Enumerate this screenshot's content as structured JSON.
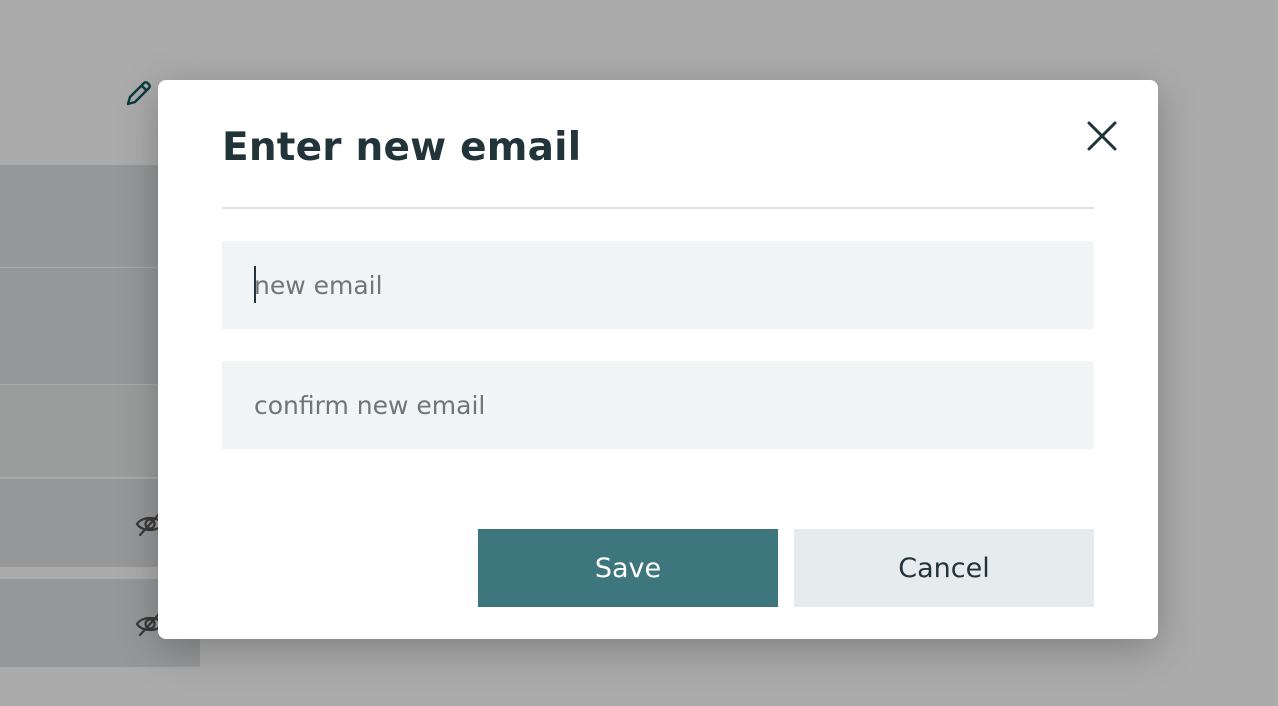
{
  "dialog": {
    "title": "Enter new email",
    "new_email": {
      "value": "",
      "placeholder": "new email"
    },
    "confirm_email": {
      "value": "",
      "placeholder": "confirm new email"
    },
    "save_label": "Save",
    "cancel_label": "Cancel"
  },
  "icons": {
    "close": "close-icon",
    "edit": "pencil-icon",
    "hidden": "eye-off-icon"
  },
  "colors": {
    "primary": "#3e767d",
    "title_text": "#21343a",
    "field_bg": "#f2f5f6",
    "secondary_button_bg": "#e6ecee",
    "overlay": "rgba(0,0,0,0.33)"
  }
}
